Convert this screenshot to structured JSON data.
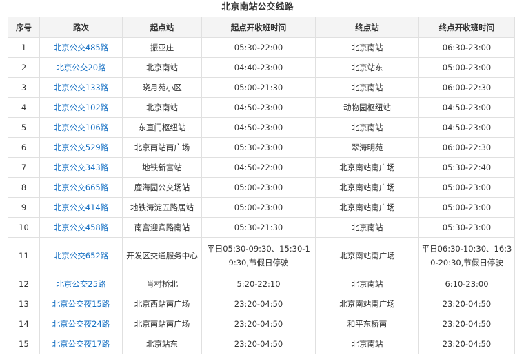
{
  "title": "北京南站公交线路",
  "headers": [
    "序号",
    "路次",
    "起点站",
    "起点开收班时间",
    "终点站",
    "终点开收班时间"
  ],
  "rows": [
    {
      "no": "1",
      "route": "北京公交485路",
      "start": "振亚庄",
      "start_time": "05:30-22:00",
      "end": "北京南站",
      "end_time": "06:30-23:00"
    },
    {
      "no": "2",
      "route": "北京公交20路",
      "start": "北京南站",
      "start_time": "04:40-23:00",
      "end": "北京站东",
      "end_time": "05:00-23:00"
    },
    {
      "no": "3",
      "route": "北京公交133路",
      "start": "晓月苑小区",
      "start_time": "05:00-21:30",
      "end": "北京南站",
      "end_time": "06:00-22:30"
    },
    {
      "no": "4",
      "route": "北京公交102路",
      "start": "北京南站",
      "start_time": "04:50-23:00",
      "end": "动物园枢纽站",
      "end_time": "04:50-23:00"
    },
    {
      "no": "5",
      "route": "北京公交106路",
      "start": "东直门枢纽站",
      "start_time": "04:50-23:00",
      "end": "北京南站",
      "end_time": "04:50-23:00"
    },
    {
      "no": "6",
      "route": "北京公交529路",
      "start": "北京南站南广场",
      "start_time": "05:30-23:00",
      "end": "翠海明苑",
      "end_time": "06:00-22:30"
    },
    {
      "no": "7",
      "route": "北京公交343路",
      "start": "地铁新宫站",
      "start_time": "04:50-22:00",
      "end": "北京南站南广场",
      "end_time": "05:30-22:40"
    },
    {
      "no": "8",
      "route": "北京公交665路",
      "start": "鹿海园公交场站",
      "start_time": "05:00-23:00",
      "end": "北京南站南广场",
      "end_time": "05:00-23:00"
    },
    {
      "no": "9",
      "route": "北京公交414路",
      "start": "地铁海淀五路居站",
      "start_time": "05:00-23:00",
      "end": "北京南站南广场",
      "end_time": "05:00-23:00"
    },
    {
      "no": "10",
      "route": "北京公交458路",
      "start": "南宫迎宾路南站",
      "start_time": "05:30-21:30",
      "end": "北京南站",
      "end_time": "05:30-23:00"
    },
    {
      "no": "11",
      "route": "北京公交652路",
      "start": "开发区交通服务中心",
      "start_time": "平日05:30-09:30、15:30-19:30,节假日停驶",
      "end": "北京南站南广场",
      "end_time": "平日06:30-10:30、16:30-20:30,节假日停驶"
    },
    {
      "no": "12",
      "route": "北京公交25路",
      "start": "肖村桥北",
      "start_time": "5:20-22:10",
      "end": "北京南站",
      "end_time": "6:10-23:00"
    },
    {
      "no": "13",
      "route": "北京公交夜15路",
      "start": "北京西站南广场",
      "start_time": "23:20-04:50",
      "end": "北京南站南广场",
      "end_time": "23:20-04:50"
    },
    {
      "no": "14",
      "route": "北京公交夜24路",
      "start": "北京南站南广场",
      "start_time": "23:20-04:50",
      "end": "和平东桥南",
      "end_time": "23:20-04:50"
    },
    {
      "no": "15",
      "route": "北京公交夜17路",
      "start": "北京站东",
      "start_time": "23:20-04:50",
      "end": "北京南站",
      "end_time": "23:20-04:50"
    }
  ],
  "colors": {
    "link": "#136ec2",
    "header_bg": "#f4f4f4",
    "border": "#e0e0e0",
    "text": "#333333"
  }
}
